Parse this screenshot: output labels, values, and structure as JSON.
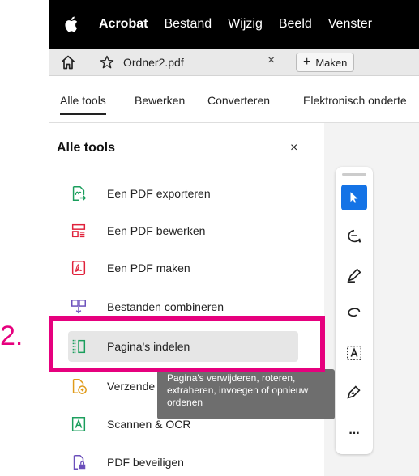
{
  "menubar": {
    "items": [
      "Acrobat",
      "Bestand",
      "Wijzig",
      "Beeld",
      "Venster"
    ]
  },
  "tabbar": {
    "tab_title": "Ordner2.pdf",
    "close_glyph": "×",
    "new_button": "Maken"
  },
  "toolnav": {
    "items": [
      "Alle tools",
      "Bewerken",
      "Converteren",
      "Elektronisch onderte"
    ]
  },
  "panel": {
    "title": "Alle tools",
    "close_glyph": "×",
    "items": [
      {
        "label": "Een PDF exporteren",
        "icon": "export-pdf-icon"
      },
      {
        "label": "Een PDF bewerken",
        "icon": "edit-pdf-icon"
      },
      {
        "label": "Een PDF maken",
        "icon": "create-pdf-icon"
      },
      {
        "label": "Bestanden combineren",
        "icon": "combine-files-icon"
      },
      {
        "label": "Pagina's indelen",
        "icon": "organize-pages-icon"
      },
      {
        "label": "Verzende",
        "icon": "send-icon"
      },
      {
        "label": "Scannen & OCR",
        "icon": "scan-ocr-icon"
      },
      {
        "label": "PDF beveiligen",
        "icon": "protect-pdf-icon"
      }
    ]
  },
  "tooltip": {
    "text": "Pagina's verwijderen, roteren, extraheren, invoegen of opnieuw ordenen"
  },
  "annotation": {
    "step": "2."
  },
  "toolbar": {
    "more_glyph": "..."
  },
  "colors": {
    "accent_blue": "#1473e6",
    "highlight_magenta": "#e6007e",
    "tool_red": "#e0213a",
    "tool_green": "#1a9e5c",
    "tool_purple": "#6b4fbb",
    "tool_orange": "#e09b1a"
  }
}
